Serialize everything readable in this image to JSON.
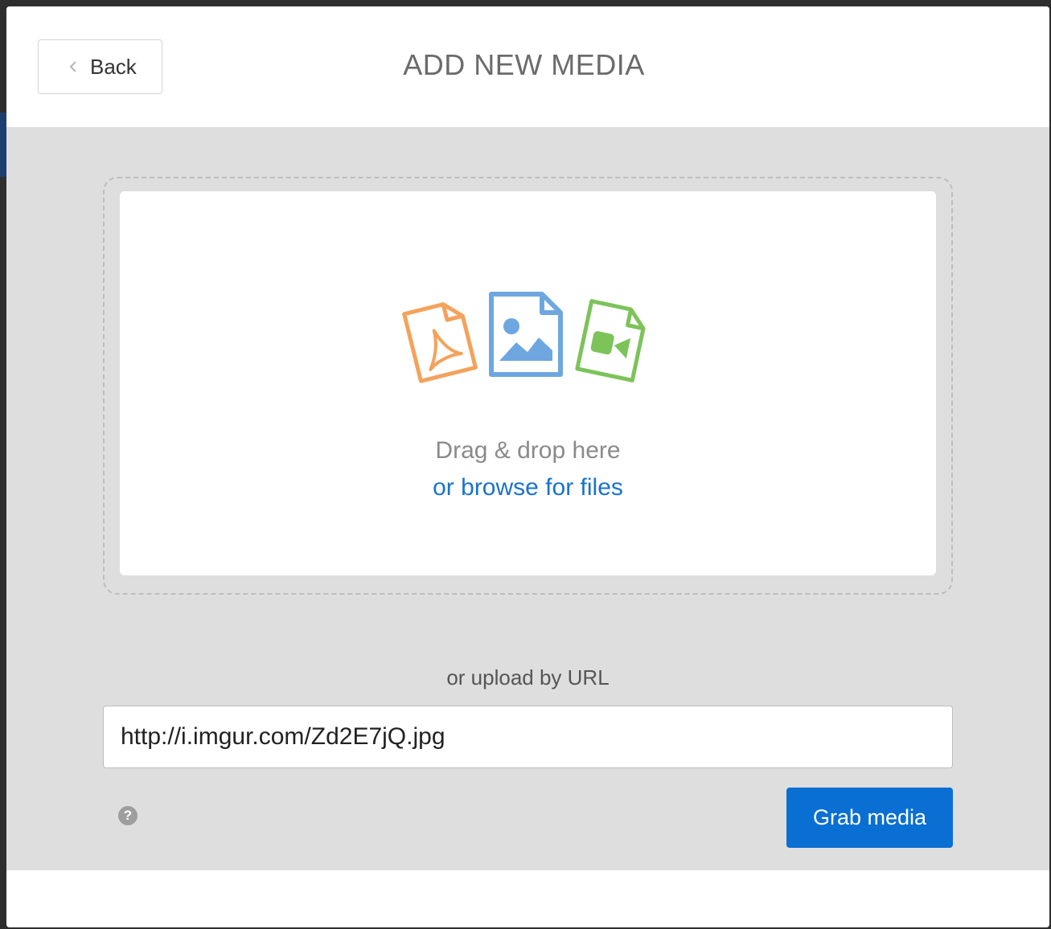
{
  "header": {
    "back_label": "Back",
    "title": "ADD NEW MEDIA"
  },
  "dropzone": {
    "drag_text": "Drag & drop here",
    "browse_text": "or browse for files",
    "icons": [
      "pdf-file-icon",
      "image-file-icon",
      "video-file-icon"
    ]
  },
  "url_upload": {
    "label": "or upload by URL",
    "value": "http://i.imgur.com/Zd2E7jQ.jpg"
  },
  "actions": {
    "help_glyph": "?",
    "grab_label": "Grab media"
  },
  "colors": {
    "pdf_icon": "#f4a25c",
    "image_icon": "#6ea7e0",
    "video_icon": "#7cc35a",
    "link": "#1a73c9",
    "primary_button": "#0a6fd3"
  }
}
